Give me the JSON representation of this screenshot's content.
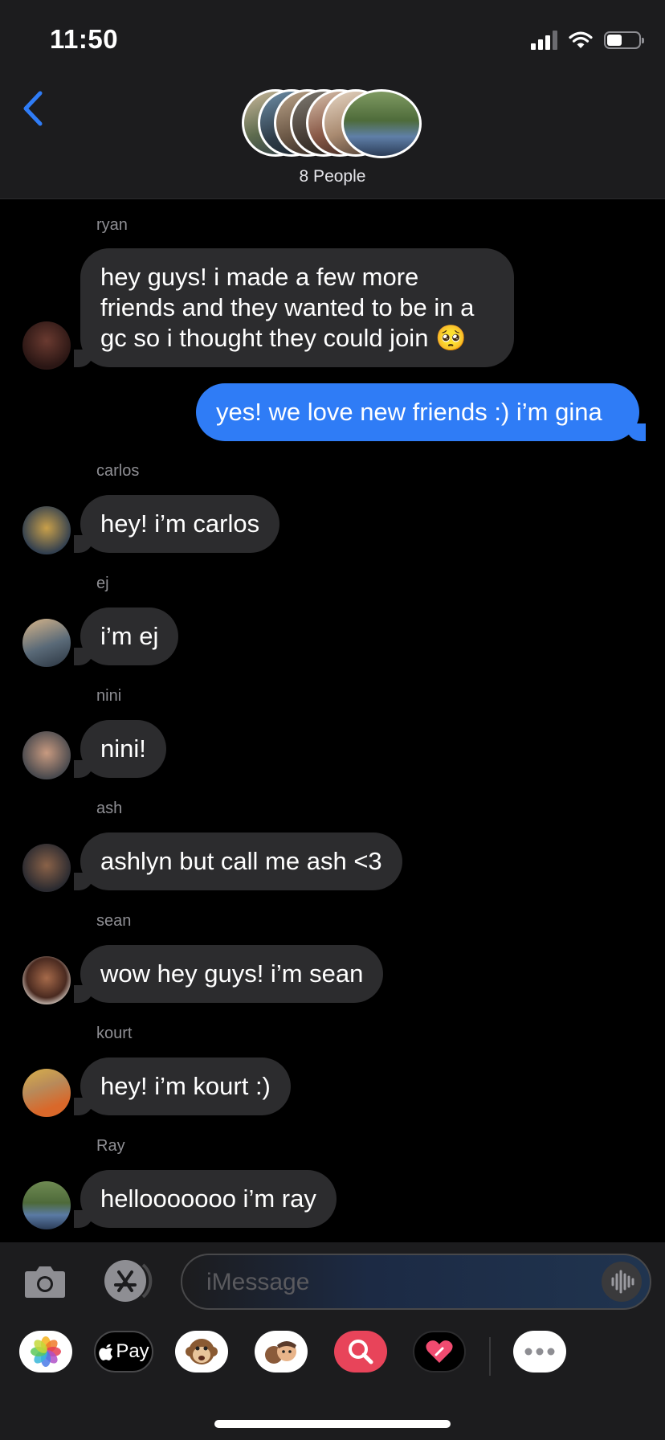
{
  "status_bar": {
    "time": "11:50"
  },
  "header": {
    "title": "8 People"
  },
  "messages": [
    {
      "sender": "ryan",
      "text_lines": [
        "hey guys! i made a few more",
        "friends and they wanted to be in a",
        "gc so i thought they could join 🥺"
      ]
    },
    {
      "sender": "",
      "text": "yes! we love new friends :) i’m gina",
      "outgoing": true
    },
    {
      "sender": "carlos",
      "text": "hey! i’m carlos"
    },
    {
      "sender": "ej",
      "text": "i’m ej"
    },
    {
      "sender": "nini",
      "text": "nini!"
    },
    {
      "sender": "ash",
      "text": "ashlyn but call me ash <3"
    },
    {
      "sender": "sean",
      "text": "wow hey guys! i’m sean"
    },
    {
      "sender": "kourt",
      "text": "hey! i’m kourt :)"
    },
    {
      "sender": "Ray",
      "text": "hellooooooo i’m ray"
    }
  ],
  "compose": {
    "placeholder": "iMessage"
  },
  "app_tray": [
    {
      "icon": "photos-icon"
    },
    {
      "icon": "apple-pay-icon",
      "label": "Pay"
    },
    {
      "icon": "animoji-icon"
    },
    {
      "icon": "memoji-icon"
    },
    {
      "icon": "image-search-icon"
    },
    {
      "icon": "digital-touch-icon"
    },
    {
      "icon": "more-apps-icon"
    }
  ],
  "colors": {
    "outgoing_bubble": "#2f7cf6",
    "incoming_bubble": "#2c2c2e",
    "accent": "#2f7cf6"
  }
}
